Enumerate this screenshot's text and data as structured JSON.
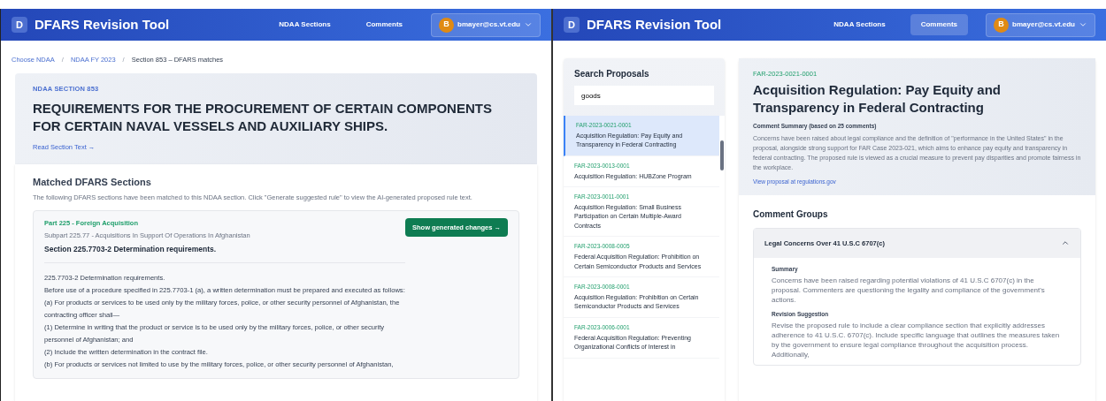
{
  "left": {
    "header": {
      "logo": "D",
      "title": "DFARS Revision Tool",
      "nav": [
        {
          "label": "NDAA Sections",
          "selected": false
        },
        {
          "label": "Comments",
          "selected": false
        }
      ],
      "user": {
        "initial": "B",
        "email": "bmayer@cs.vt.edu"
      }
    },
    "breadcrumb": [
      "Choose NDAA",
      "NDAA FY 2023",
      "Section 853 – DFARS matches"
    ],
    "breadcrumb_separator": "/",
    "section": {
      "label": "NDAA SECTION 853",
      "title": "REQUIREMENTS FOR THE PROCUREMENT OF CERTAIN COMPONENTS FOR CERTAIN NAVAL VESSELS AND AUXILIARY SHIPS.",
      "link": "Read Section Text →"
    },
    "matched": {
      "heading": "Matched DFARS Sections",
      "description": "The following DFARS sections have been matched to this NDAA section. Click \"Generate suggested rule\" to view the AI-generated proposed rule text.",
      "card": {
        "part": "Part 225 - Foreign Acquisition",
        "subpart": "Subpart 225.77 - Acquisitions In Support Of Operations In Afghanistan",
        "section": "Section 225.7703-2 Determination requirements.",
        "button": "Show generated changes →",
        "lines": [
          "225.7703-2 Determination requirements.",
          "Before use of a procedure specified in 225.7703-1 (a), a written determination must be prepared and executed as follows:",
          "(a) For products or services to be used only by the military forces, police, or other security personnel of Afghanistan, the contracting officer shall—",
          "(1) Determine in writing that the product or service is to be used only by the military forces, police, or other security personnel of Afghanistan; and",
          "(2) Include the written determination in the contract file.",
          "(b) For products or services not limited to use by the military forces, police, or other security personnel of Afghanistan,"
        ]
      }
    }
  },
  "right": {
    "header": {
      "logo": "D",
      "title": "DFARS Revision Tool",
      "nav": [
        {
          "label": "NDAA Sections",
          "selected": false
        },
        {
          "label": "Comments",
          "selected": true
        }
      ],
      "user": {
        "initial": "B",
        "email": "bmayer@cs.vt.edu"
      }
    },
    "search": {
      "title": "Search Proposals",
      "value": "goods"
    },
    "proposals": [
      {
        "id": "FAR-2023-0021-0001",
        "title": "Acquisition Regulation: Pay Equity and Transparency in Federal Contracting",
        "selected": true
      },
      {
        "id": "FAR-2023-0013-0001",
        "title": "Acquisition Regulation: HUBZone Program",
        "selected": false
      },
      {
        "id": "FAR-2023-0011-0001",
        "title": "Acquisition Regulation: Small Business Participation on Certain Multiple-Award Contracts",
        "selected": false
      },
      {
        "id": "FAR-2023-0008-0005",
        "title": "Federal Acquisition Regulation: Prohibition on Certain Semiconductor Products and Services",
        "selected": false
      },
      {
        "id": "FAR-2023-0008-0001",
        "title": "Acquisition Regulation: Prohibition on Certain Semiconductor Products and Services",
        "selected": false
      },
      {
        "id": "FAR-2023-0006-0001",
        "title": "Federal Acquisition Regulation: Preventing Organizational Conflicts of Interest in",
        "selected": false
      }
    ],
    "detail": {
      "id": "FAR-2023-0021-0001",
      "title": "Acquisition Regulation: Pay Equity and Transparency in Federal Contracting",
      "summary_label": "Comment Summary (based on 25 comments)",
      "summary": "Concerns have been raised about legal compliance and the definition of \"performance in the United States\" in the proposal, alongside strong support for FAR Case 2023-021, which aims to enhance pay equity and transparency in federal contracting. The proposed rule is viewed as a crucial measure to prevent pay disparities and promote fairness in the workplace.",
      "link": "View proposal at regulations.gov"
    },
    "comment_groups": {
      "heading": "Comment Groups",
      "groups": [
        {
          "title": "Legal Concerns Over 41 U.S.C 6707(c)",
          "expanded": true,
          "sections": [
            {
              "heading": "Summary",
              "text": "Concerns have been raised regarding potential violations of 41 U.S.C 6707(c) in the proposal. Commenters are questioning the legality and compliance of the government's actions."
            },
            {
              "heading": "Revision Suggestion",
              "text": "Revise the proposed rule to include a clear compliance section that explicitly addresses adherence to 41 U.S.C. 6707(c). Include specific language that outlines the measures taken by the government to ensure legal compliance throughout the acquisition process. Additionally,"
            }
          ]
        }
      ]
    }
  }
}
